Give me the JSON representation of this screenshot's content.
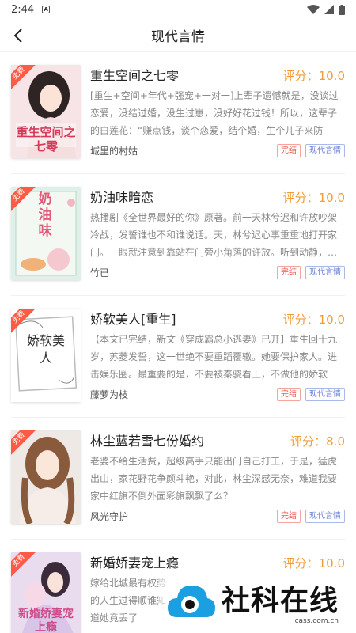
{
  "status_bar": {
    "time": "2:44",
    "a_icon": "A"
  },
  "header": {
    "title": "现代言情",
    "back_icon": "chevron-left-icon"
  },
  "books": [
    {
      "title": "重生空间之七零",
      "score_label": "评分：10.0",
      "description": "[重生+空间+年代+强宠+一对一]上辈子遗憾就是，没谈过恋爱，没结过婚，没生过崽，没好好花过钱！所以，这辈子的白莲花：“赚点钱，谈个恋爱，结个婚，生个儿子来防老！”…",
      "author": "城里的村姑",
      "status_tag": "完结",
      "category_tag": "现代言情",
      "free_tag": "免费",
      "cover_text": "重生空间之七零"
    },
    {
      "title": "奶油味暗恋",
      "score_label": "评分：10.0",
      "description": "热播剧《全世界最好的你》原著。前一天林兮迟和许放吵架冷战，发誓谁也不和谁说话。天，林兮迟心事重重地打开家门。一眼就注意到靠站在门旁小角落的许放。听到动静，…",
      "author": "竹已",
      "status_tag": "完结",
      "category_tag": "现代言情",
      "free_tag": "免费",
      "cover_text": "奶油味"
    },
    {
      "title": "娇软美人[重生]",
      "score_label": "评分：10.0",
      "description": "【本文已完结，新文《穿成霸总小逃妻》已开】重生回十九岁，苏菱发誓，这一世绝不要重蹈覆辙。她要保护家人。进击娱乐圈。最重要的是，不要被秦骁看上，不做他的娇软情…",
      "author": "藤萝为枝",
      "status_tag": "完结",
      "category_tag": "现代言情",
      "free_tag": "免费",
      "cover_text": "娇软美人"
    },
    {
      "title": "林尘蓝若雪七份婚约",
      "score_label": "评分：8.0",
      "description": "老婆不给生活费，超级高手只能出门自己打工，于是，猛虎出山，家花野花争颜斗艳，对此，林尘深感无奈，难道我要家中红旗不倒外面彩旗飘飘了么？",
      "author": "风光守护",
      "status_tag": "完结",
      "category_tag": "现代言情",
      "free_tag": "免费",
      "cover_text": ""
    },
    {
      "title": "新婚娇妻宠上瘾",
      "score_label": "评分：10.0",
      "description": "嫁给北城最有权势的人生过得顺谁知道她竟丢了",
      "author": "",
      "status_tag": "",
      "category_tag": "",
      "free_tag": "免费",
      "cover_text": "新婚娇妻宠上瘾"
    }
  ],
  "watermark": {
    "main": "社科在线",
    "sub": "cass.com.cn"
  },
  "colors": {
    "score": "#f29c38",
    "free_tag": "#ff5a45",
    "tag_red": "#e8574b",
    "tag_blue": "#6a83d6"
  }
}
